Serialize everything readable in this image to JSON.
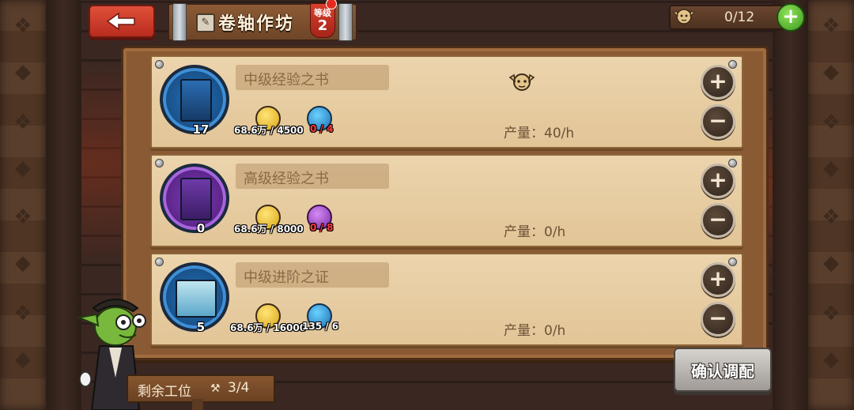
{
  "header": {
    "back_icon": "arrow-left-icon",
    "title": "卷轴作坊",
    "title_icon": "scroll-icon",
    "level_label": "等级",
    "level_value": "2",
    "workers_count": "0/12",
    "add_workers_icon": "plus-icon"
  },
  "items": [
    {
      "name": "中级经验之书",
      "count": "17",
      "circle_color": "blue",
      "gold_cost": "68.6万 / 4500",
      "material_cost": "0 / 4",
      "material_icon": "blue-crystal-icon",
      "material_insufficient": true,
      "output": "产量：40/h",
      "has_worker": true
    },
    {
      "name": "高级经验之书",
      "count": "0",
      "circle_color": "purple",
      "gold_cost": "68.6万 / 8000",
      "material_cost": "0 / 8",
      "material_icon": "purple-crystal-icon",
      "material_insufficient": true,
      "output": "产量：0/h",
      "has_worker": false
    },
    {
      "name": "中级进阶之证",
      "count": "5",
      "circle_color": "blue",
      "gold_cost": "68.6万 / 16000",
      "material_cost": "135 / 6",
      "material_icon": "blue-gem-icon",
      "material_insufficient": false,
      "output": "产量：0/h",
      "has_worker": false
    }
  ],
  "buttons": {
    "plus": "+",
    "minus": "−",
    "confirm": "确认调配"
  },
  "footer": {
    "remaining_label": "剩余工位",
    "remaining_value": "3/4"
  },
  "colors": {
    "board": "#8a5a34",
    "row_paper": "#e6cba0",
    "back_button": "#c83a28",
    "add_green": "#4fb52a",
    "insufficient_red": "#ff3b3b"
  }
}
